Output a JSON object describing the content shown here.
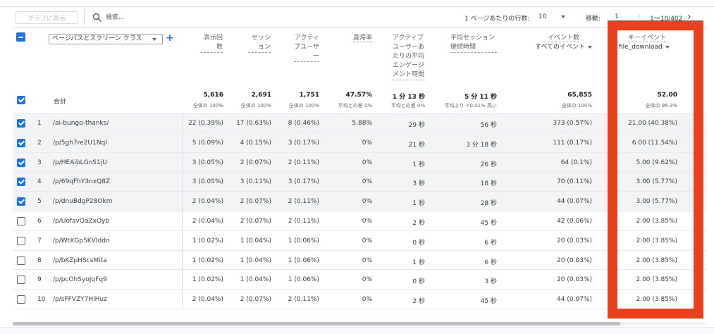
{
  "toolbar": {
    "chart_button": "グラフに表示",
    "search_placeholder": "検索...",
    "rows_per_page_label": "1 ページあたりの行数:",
    "rows_per_page_value": "10",
    "goto_label": "移動:",
    "goto_value": "1",
    "page_range": "1〜10/402",
    "prev_icon": "chevron-left-icon",
    "next_icon": "chevron-right-icon"
  },
  "dimension": {
    "label": "ページパスとスクリーン クラス",
    "add_icon": "plus-icon"
  },
  "columns": [
    {
      "label": "表示回数"
    },
    {
      "label": "セッション"
    },
    {
      "label": "アクティブユーザー"
    },
    {
      "label": "直帰率"
    },
    {
      "label": "アクティブユーザーあたりの平均エンゲージメント時間"
    },
    {
      "label": "平均セッション継続時間"
    },
    {
      "label": "イベント数",
      "sub": "すべてのイベント"
    },
    {
      "label": "キーイベント",
      "sub": "file_download"
    }
  ],
  "totals": {
    "label": "合計",
    "values": [
      "5,616",
      "2,691",
      "1,751",
      "47.57%",
      "1 分 13 秒",
      "5 分 11 秒",
      "65,855",
      "52.00"
    ],
    "subs": [
      "全体の 100%",
      "全体の 100%",
      "全体の 100%",
      "平均との差 0%",
      "平均との差 0%",
      "平均より <0.01% 高い",
      "全体の 100%",
      "全体の 96.3%"
    ]
  },
  "rows": [
    {
      "n": "1",
      "checked": true,
      "path": "/ai-bungo-thanks/",
      "v": [
        "22 (0.39%)",
        "17 (0.63%)",
        "8 (0.46%)",
        "5.88%",
        "29 秒",
        "56 秒",
        "373 (0.57%)",
        "21.00 (40.38%)"
      ]
    },
    {
      "n": "2",
      "checked": true,
      "path": "/p/5gh7re2U1NqI",
      "v": [
        "5 (0.09%)",
        "4 (0.15%)",
        "3 (0.17%)",
        "0%",
        "21 秒",
        "3 分 18 秒",
        "111 (0.17%)",
        "6.00 (11.54%)"
      ]
    },
    {
      "n": "3",
      "checked": true,
      "path": "/p/HEAibLGnS1jU",
      "v": [
        "3 (0.05%)",
        "2 (0.07%)",
        "2 (0.11%)",
        "0%",
        "1 秒",
        "26 秒",
        "64 (0.1%)",
        "5.00 (9.62%)"
      ]
    },
    {
      "n": "4",
      "checked": true,
      "path": "/p/69qFhY3nxQ8Z",
      "v": [
        "3 (0.05%)",
        "3 (0.11%)",
        "3 (0.17%)",
        "0%",
        "3 秒",
        "18 秒",
        "70 (0.11%)",
        "3.00 (5.77%)"
      ]
    },
    {
      "n": "5",
      "checked": true,
      "path": "/p/dnuBdgP28Okm",
      "v": [
        "2 (0.04%)",
        "2 (0.07%)",
        "2 (0.11%)",
        "0%",
        "1 秒",
        "28 秒",
        "44 (0.07%)",
        "3.00 (5.77%)"
      ]
    },
    {
      "n": "6",
      "checked": false,
      "path": "/p/UofavQaZxOyb",
      "v": [
        "2 (0.04%)",
        "2 (0.07%)",
        "2 (0.11%)",
        "0%",
        "2 秒",
        "45 秒",
        "42 (0.06%)",
        "2.00 (3.85%)"
      ]
    },
    {
      "n": "7",
      "checked": false,
      "path": "/p/WtXGp5KVIddn",
      "v": [
        "1 (0.02%)",
        "1 (0.04%)",
        "1 (0.06%)",
        "0%",
        "0 秒",
        "6 秒",
        "20 (0.03%)",
        "2.00 (3.85%)"
      ]
    },
    {
      "n": "8",
      "checked": false,
      "path": "/p/bKZpHScsMita",
      "v": [
        "1 (0.02%)",
        "1 (0.04%)",
        "1 (0.06%)",
        "0%",
        "1 秒",
        "6 秒",
        "20 (0.03%)",
        "2.00 (3.85%)"
      ]
    },
    {
      "n": "9",
      "checked": false,
      "path": "/p/pcOhSyoJqFq9",
      "v": [
        "1 (0.02%)",
        "1 (0.04%)",
        "1 (0.06%)",
        "0%",
        "0 秒",
        "3 秒",
        "20 (0.03%)",
        "2.00 (3.85%)"
      ]
    },
    {
      "n": "10",
      "checked": false,
      "path": "/p/sFFVZY7HiHuz",
      "v": [
        "2 (0.04%)",
        "2 (0.07%)",
        "2 (0.11%)",
        "0%",
        "2 秒",
        "45 秒",
        "44 (0.07%)",
        "2.00 (3.85%)"
      ]
    }
  ],
  "colors": {
    "accent": "#1a73e8",
    "highlight": "#e8411e",
    "row_shade": "#f1f3f4"
  }
}
